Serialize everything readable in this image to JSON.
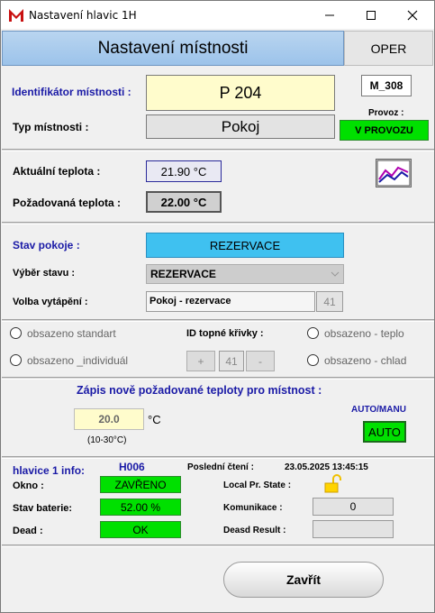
{
  "window": {
    "title": "Nastavení hlavic 1H",
    "minimize": "—",
    "maximize": "☐",
    "close": "✕"
  },
  "header": {
    "title": "Nastavení místnosti",
    "mode_tab": "OPER"
  },
  "room": {
    "id_label": "Identifikátor místnosti :",
    "id_value": "P 204",
    "code": "M_308",
    "type_label": "Typ místnosti :",
    "type_value": "Pokoj",
    "provoz_label": "Provoz :",
    "provoz_value": "V PROVOZU"
  },
  "temps": {
    "actual_label": "Aktuální teplota :",
    "actual_value": "21.90 °C",
    "required_label": "Požadovaná teplota :",
    "required_value": "22.00 °C",
    "chart_icon": "chart-icon"
  },
  "state": {
    "label": "Stav pokoje :",
    "value": "REZERVACE",
    "select_label": "Výběr stavu :",
    "select_value": "REZERVACE",
    "heating_label": "Volba vytápění :",
    "heating_value": "Pokoj - rezervace",
    "heating_num": "41"
  },
  "curves": {
    "opt1": "obsazeno standart",
    "opt2": "obsazeno _individuál",
    "curve_label": "ID topné křivky :",
    "plus": "+",
    "curve_value": "41",
    "minus": "-",
    "opt3": "obsazeno - teplo",
    "opt4": "obsazeno - chlad"
  },
  "setpoint": {
    "title": "Zápis nově požadované teploty pro místnost :",
    "value": "20.0",
    "unit": "°C",
    "range": "(10-30°C)",
    "automanu_label": "AUTO/MANU",
    "automanu_value": "AUTO"
  },
  "head_info": {
    "title": "hlavice 1 info:",
    "id": "H006",
    "last_read_label": "Poslední čtení :",
    "last_read_value": "23.05.2025 13:45:15",
    "window_label": "Okno :",
    "window_value": "ZAVŘENO",
    "local_label": "Local Pr. State :",
    "battery_label": "Stav baterie:",
    "battery_value": "52.00 %",
    "comm_label": "Komunikace :",
    "comm_value": "0",
    "dead_label": "Dead :",
    "dead_value": "OK",
    "dead_result_label": "Deasd Result :",
    "dead_result_value": ""
  },
  "footer": {
    "close_label": "Zavřít"
  },
  "colors": {
    "accent_blue": "#3fc1f0",
    "green": "#00e000",
    "yellow_field": "#fffccc"
  }
}
